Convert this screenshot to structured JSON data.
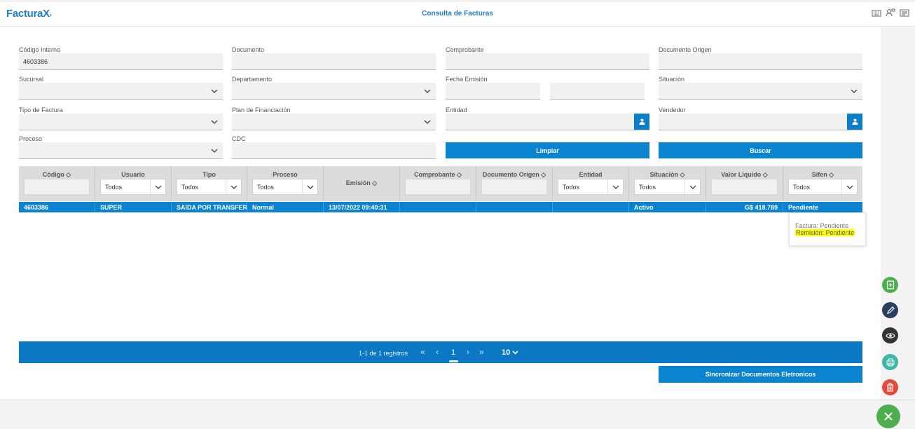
{
  "app": {
    "logo": "Factura",
    "logo_x": "X",
    "title": "Consulta de Facturas"
  },
  "top_icons": [
    "keyboard-icon",
    "users-settings-icon",
    "id-card-icon"
  ],
  "form": {
    "codigo_interno": {
      "label": "Código Interno",
      "value": "4603386"
    },
    "documento": {
      "label": "Documento",
      "value": ""
    },
    "comprobante": {
      "label": "Comprobante",
      "value": ""
    },
    "documento_origen": {
      "label": "Documento Origen",
      "value": ""
    },
    "sucursal": {
      "label": "Sucursal",
      "value": ""
    },
    "departamento": {
      "label": "Departamento",
      "value": ""
    },
    "fecha_emision": {
      "label": "Fecha Emisión",
      "from": "",
      "to": ""
    },
    "situacion": {
      "label": "Situación",
      "value": ""
    },
    "tipo_factura": {
      "label": "Tipo de Factura",
      "value": ""
    },
    "plan_financiacion": {
      "label": "Plan de Financiación",
      "value": ""
    },
    "entidad": {
      "label": "Entidad",
      "value": ""
    },
    "vendedor": {
      "label": "Vendedor",
      "value": ""
    },
    "proceso": {
      "label": "Proceso",
      "value": ""
    },
    "cdc": {
      "label": "CDC",
      "value": ""
    },
    "limpiar": "Limpiar",
    "buscar": "Buscar"
  },
  "grid": {
    "columns": [
      {
        "label": "Código ◇",
        "filter": "input"
      },
      {
        "label": "Usuario",
        "filter": "select",
        "value": "Todos"
      },
      {
        "label": "Tipo",
        "filter": "select",
        "value": "Todos"
      },
      {
        "label": "Proceso",
        "filter": "select",
        "value": "Todos"
      },
      {
        "label": "Emisión ◇",
        "filter": "none"
      },
      {
        "label": "Comprobante ◇",
        "filter": "input"
      },
      {
        "label": "Documento Origen ◇",
        "filter": "input"
      },
      {
        "label": "Entidad",
        "filter": "select",
        "value": "Todos"
      },
      {
        "label": "Situación ◇",
        "filter": "select",
        "value": "Todos"
      },
      {
        "label": "Valor Liquido ◇",
        "filter": "input"
      },
      {
        "label": "Sifen ◇",
        "filter": "select",
        "value": "Todos"
      }
    ],
    "rows": [
      [
        "4603386",
        "SUPER",
        "SAIDA POR TRANSFERENCIA",
        "Normal",
        "13/07/2022 09:40:31",
        "",
        "",
        "",
        "Activo",
        "G$ 418.789",
        "Pendiente"
      ]
    ]
  },
  "tooltip": {
    "line1": "Factura: Pendiente",
    "line2": "Remisión: Pendiente"
  },
  "pager": {
    "info": "1-1 de 1 registros",
    "page": "1",
    "page_size": "10"
  },
  "sync_button": "Sincronizar Documentos Eletronicos",
  "fab_colors": {
    "add": "#4cae4c",
    "edit": "#2a3f5f",
    "view": "#333333",
    "print": "#3fb5a6",
    "delete": "#e24a3b",
    "close": "#4cae4c"
  }
}
